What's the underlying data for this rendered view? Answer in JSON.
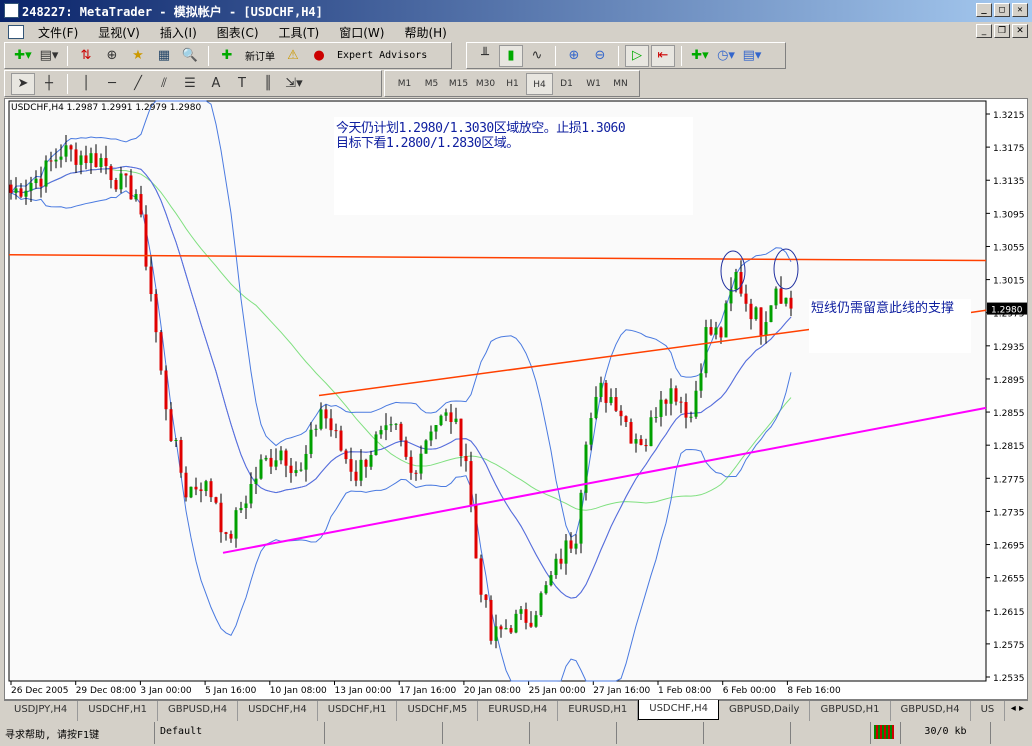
{
  "window": {
    "title": "248227: MetaTrader - 模拟帐户 - [USDCHF,H4]"
  },
  "menu": [
    "文件(F)",
    "显视(V)",
    "插入(I)",
    "图表(C)",
    "工具(T)",
    "窗口(W)",
    "帮助(H)"
  ],
  "toolbar": {
    "new_order": "新订单",
    "expert_advisors": "Expert Advisors"
  },
  "timeframes": [
    "M1",
    "M5",
    "M15",
    "M30",
    "H1",
    "H4",
    "D1",
    "W1",
    "MN"
  ],
  "active_timeframe": "H4",
  "chart": {
    "info": "USDCHF,H4  1.2987 1.2991 1.2979 1.2980",
    "note1_line1": "今天仍计划1.2980/1.3030区域放空。止损1.3060",
    "note1_line2": "目标下看1.2800/1.2830区域。",
    "note2": "短线仍需留意此线的支撑",
    "current_price": "1.2980"
  },
  "chart_data": {
    "type": "candlestick",
    "symbol": "USDCHF",
    "timeframe": "H4",
    "y_ticks": [
      "1.3215",
      "1.3175",
      "1.3135",
      "1.3095",
      "1.3055",
      "1.3015",
      "1.2975",
      "1.2935",
      "1.2895",
      "1.2855",
      "1.2815",
      "1.2775",
      "1.2735",
      "1.2695",
      "1.2655",
      "1.2615",
      "1.2575",
      "1.2535"
    ],
    "ylim": [
      1.2535,
      1.3215
    ],
    "x_labels": [
      "26 Dec 2005",
      "29 Dec 08:00",
      "3 Jan 00:00",
      "5 Jan 16:00",
      "10 Jan 08:00",
      "13 Jan 00:00",
      "17 Jan 16:00",
      "20 Jan 08:00",
      "25 Jan 00:00",
      "27 Jan 16:00",
      "1 Feb 08:00",
      "6 Feb 00:00",
      "8 Feb 16:00"
    ],
    "close_waypoints": [
      [
        0,
        1.312
      ],
      [
        6,
        1.314
      ],
      [
        10,
        1.317
      ],
      [
        18,
        1.316
      ],
      [
        22,
        1.313
      ],
      [
        25,
        1.312
      ],
      [
        28,
        1.3
      ],
      [
        30,
        1.29
      ],
      [
        32,
        1.283
      ],
      [
        35,
        1.276
      ],
      [
        38,
        1.277
      ],
      [
        41,
        1.275
      ],
      [
        43,
        1.2695
      ],
      [
        46,
        1.274
      ],
      [
        50,
        1.279
      ],
      [
        54,
        1.281
      ],
      [
        58,
        1.278
      ],
      [
        62,
        1.286
      ],
      [
        66,
        1.281
      ],
      [
        69,
        1.278
      ],
      [
        73,
        1.282
      ],
      [
        77,
        1.283
      ],
      [
        80,
        1.278
      ],
      [
        84,
        1.284
      ],
      [
        88,
        1.285
      ],
      [
        91,
        1.28
      ],
      [
        93,
        1.268
      ],
      [
        96,
        1.258
      ],
      [
        100,
        1.26
      ],
      [
        104,
        1.261
      ],
      [
        107,
        1.264
      ],
      [
        110,
        1.268
      ],
      [
        113,
        1.271
      ],
      [
        115,
        1.283
      ],
      [
        118,
        1.288
      ],
      [
        121,
        1.287
      ],
      [
        124,
        1.283
      ],
      [
        127,
        1.282
      ],
      [
        130,
        1.288
      ],
      [
        133,
        1.288
      ],
      [
        136,
        1.285
      ],
      [
        139,
        1.295
      ],
      [
        142,
        1.295
      ],
      [
        145,
        1.302
      ],
      [
        147,
        1.299
      ],
      [
        150,
        1.296
      ],
      [
        153,
        1.301
      ],
      [
        156,
        1.298
      ]
    ],
    "indicators": [
      "Bollinger Bands(20,2)",
      "MA 20",
      "MA 50"
    ],
    "lines": {
      "resistance_horizontal": [
        1.3045,
        1.3038
      ],
      "channel_top": [
        1.2875,
        1.2955
      ],
      "channel_bottom": [
        1.2685,
        1.286
      ]
    },
    "colors": {
      "up": "#00a000",
      "down": "#e00000",
      "bands": "#4a7ae0",
      "ma_fast": "#c030c0",
      "ma_slow": "#80e080",
      "orange": "#ff4000",
      "magenta": "#ff00ff"
    }
  },
  "tabs": [
    "USDJPY,H4",
    "USDCHF,H1",
    "GBPUSD,H4",
    "USDCHF,H4",
    "USDCHF,H1",
    "USDCHF,M5",
    "EURUSD,H4",
    "EURUSD,H1",
    "USDCHF,H4",
    "GBPUSD,Daily",
    "GBPUSD,H1",
    "GBPUSD,H4",
    "US"
  ],
  "active_tab": 8,
  "status": {
    "help": "寻求帮助, 请按F1键",
    "profile": "Default",
    "traffic": "30/0 kb"
  }
}
